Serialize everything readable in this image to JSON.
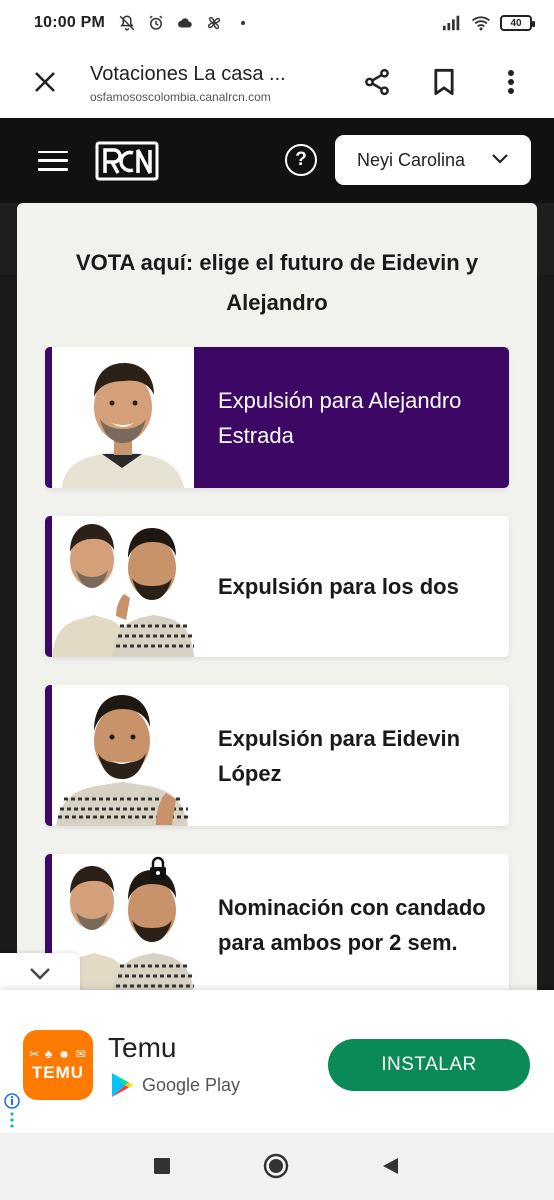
{
  "status_bar": {
    "time": "10:00 PM",
    "battery": "40"
  },
  "browser": {
    "title": "Votaciones La casa ...",
    "url": "osfamososcolombia.canalrcn.com"
  },
  "header": {
    "logo_text": "RCN",
    "help_symbol": "?",
    "profile_name": "Neyi Carolina"
  },
  "vote": {
    "title": "VOTA aquí: elige el futuro de Eidevin y Alejandro",
    "options": [
      {
        "label": "Expulsión para Alejandro Estrada",
        "selected": true
      },
      {
        "label": "Expulsión para los dos",
        "selected": false
      },
      {
        "label": "Expulsión para Eidevin López",
        "selected": false
      },
      {
        "label": "Nominación con candado para ambos por 2 sem.",
        "selected": false
      }
    ]
  },
  "ad": {
    "logo_text": "TEMU",
    "app_name": "Temu",
    "store": "Google Play",
    "button": "INSTALAR"
  },
  "colors": {
    "accent_purple": "#3d0766",
    "install_green": "#0a8a55",
    "temu_orange": "#ff7a00",
    "header_black": "#111111"
  }
}
